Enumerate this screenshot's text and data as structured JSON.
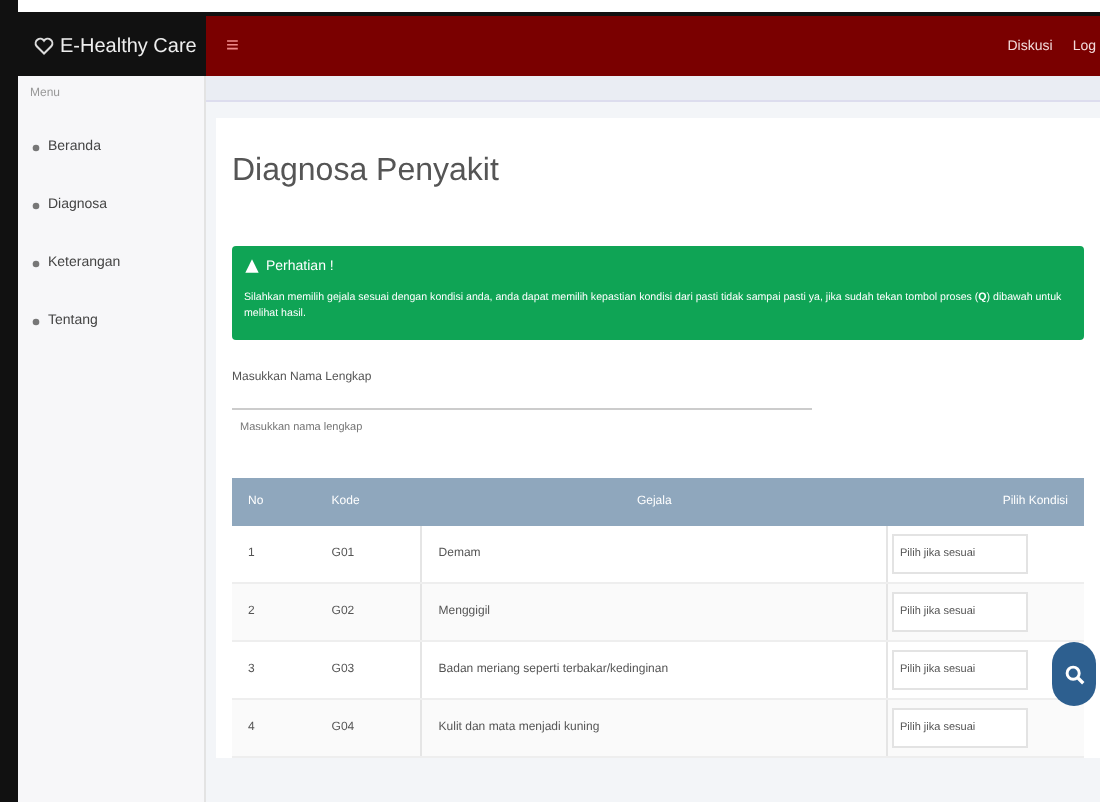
{
  "brand": {
    "title": "E-Healthy Care"
  },
  "topbar": {
    "menu_glyph": "≡",
    "links": [
      {
        "label": "Diskusi"
      },
      {
        "label": "Log"
      }
    ]
  },
  "sidebar": {
    "heading": "Menu",
    "items": [
      {
        "label": "Beranda"
      },
      {
        "label": "Diagnosa"
      },
      {
        "label": "Keterangan"
      },
      {
        "label": "Tentang"
      }
    ]
  },
  "page": {
    "title": "Diagnosa Penyakit"
  },
  "alert": {
    "title": "Perhatian !",
    "text": "Silahkan memilih gejala sesuai dengan kondisi anda, anda dapat memilih kepastian kondisi dari pasti tidak sampai pasti ya, jika sudah tekan tombol proses (**Q**) dibawah untuk melihat hasil."
  },
  "name_field": {
    "label": "Masukkan Nama Lengkap",
    "placeholder": "Masukkan nama lengkap"
  },
  "table": {
    "columns": [
      "No",
      "Kode",
      "Gejala",
      "Pilih Kondisi"
    ],
    "rows": [
      {
        "no": "1",
        "code": "G01",
        "symptom": "Demam",
        "choice": "Pilih jika sesuai"
      },
      {
        "no": "2",
        "code": "G02",
        "symptom": "Menggigil",
        "choice": "Pilih jika sesuai"
      },
      {
        "no": "3",
        "code": "G03",
        "symptom": "Badan meriang seperti terbakar/kedinginan",
        "choice": "Pilih jika sesuai"
      },
      {
        "no": "4",
        "code": "G04",
        "symptom": "Kulit dan mata menjadi kuning",
        "choice": "Pilih jika sesuai"
      }
    ]
  }
}
